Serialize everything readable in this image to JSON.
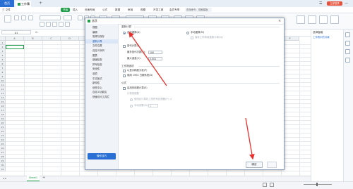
{
  "titlebar": {
    "home_label": "首页",
    "doc_tab": "工作簿1",
    "tab_add": "+",
    "login_label": "立即登录",
    "minimize": "—",
    "maximize": "□",
    "close": "✕"
  },
  "menu": {
    "items": [
      "三 文件",
      "开始",
      "插入",
      "页面布局",
      "公式",
      "数据",
      "审阅",
      "视图",
      "开发工具",
      "会员专享"
    ],
    "search_label": "查找命令、搜索模板"
  },
  "formula": {
    "namebox": "A1",
    "fx": "fx"
  },
  "grid": {
    "columns": [
      "A",
      "B",
      "C",
      "D",
      "E",
      "F",
      "G",
      "H",
      "I",
      "J",
      "K",
      "L",
      "M",
      "N",
      "O",
      "P"
    ],
    "rows": [
      "1",
      "2",
      "3",
      "4",
      "5",
      "6",
      "7",
      "8",
      "9",
      "10",
      "11",
      "12",
      "13",
      "14",
      "15",
      "16",
      "17",
      "18",
      "19",
      "20",
      "21",
      "22",
      "23",
      "24",
      "25",
      "26",
      "27",
      "28",
      "29",
      "30",
      "31"
    ]
  },
  "sheet": {
    "tab": "Sheet1",
    "add": "+"
  },
  "right_panel": {
    "title": "选择窗格",
    "link": "工作表中的对象"
  },
  "dialog": {
    "title": "选项",
    "nav": [
      "视图",
      "编辑",
      "常规与保存",
      "重新计算",
      "文件位置",
      "自定义序列",
      "图表",
      "错误检查",
      "拼写检查",
      "安全性",
      "选项",
      "中文版式",
      "新特性",
      "信任中心",
      "自定义功能区",
      "快速访问工具栏"
    ],
    "nav_active_index": 3,
    "tips_label": "操作技巧",
    "section_recalc": "重新计算",
    "auto_recalc": "自动重算(A)",
    "manual_recalc": "手动重算(M)",
    "recalc_before_save": "保存工作簿前重新计算(W)",
    "iteration": "迭代计算(I)",
    "max_iterations_label": "最多迭代次数(X):",
    "max_iterations_value": "100",
    "max_change_label": "最大误差(C):",
    "max_change_value": "0.001",
    "section_workbook": "工作簿选项",
    "precision_as_displayed": "以显示精度为准(P)",
    "date_1904": "使用 1904 日期系统(D)",
    "section_formula": "公式",
    "multithread": "启用多线程计算(E)",
    "threads_label": "计算线程数",
    "use_all_processors": "使用此计算机上的所有处理器(P): 4",
    "manual_threads": "手动设置(M):",
    "manual_threads_value": "4",
    "ok_label": "确定"
  }
}
